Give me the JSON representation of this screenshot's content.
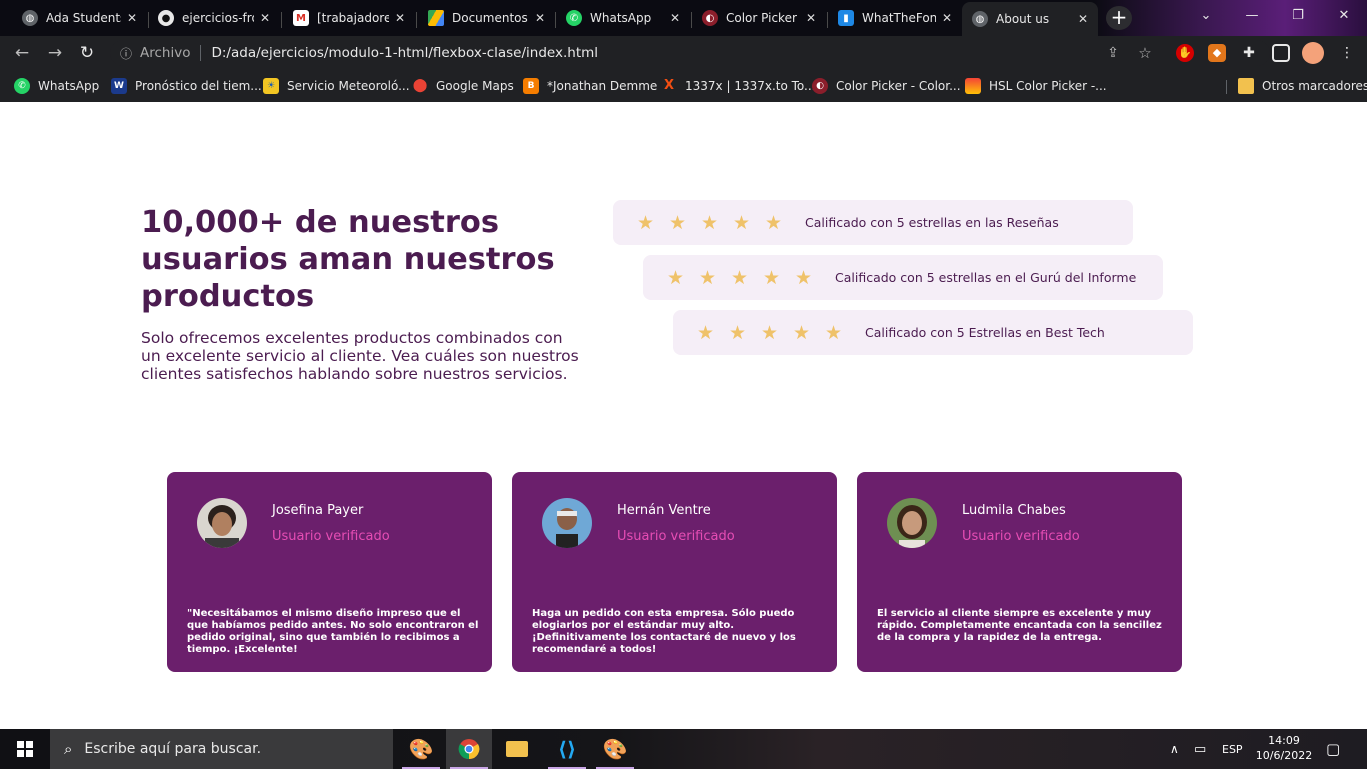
{
  "browser": {
    "tabs": [
      {
        "title": "Ada Students",
        "icon": "globe-icon",
        "active": false
      },
      {
        "title": "ejercicios-fron",
        "icon": "github-icon",
        "active": false
      },
      {
        "title": "[trabajadores]",
        "icon": "gmail-icon",
        "active": false
      },
      {
        "title": "Documentos",
        "icon": "google-drive-icon",
        "active": false
      },
      {
        "title": "WhatsApp",
        "icon": "whatsapp-icon",
        "active": false
      },
      {
        "title": "Color Picker -",
        "icon": "color-picker-icon",
        "active": false
      },
      {
        "title": "WhatTheFont",
        "icon": "whatthefont-icon",
        "active": false
      },
      {
        "title": "About us",
        "icon": "globe-icon",
        "active": true
      }
    ],
    "address": {
      "scheme_label": "Archivo",
      "url": "D:/ada/ejercicios/modulo-1-html/flexbox-clase/index.html"
    },
    "bookmarks": [
      {
        "label": "WhatsApp",
        "icon": "whatsapp-icon"
      },
      {
        "label": "Pronóstico del tiem...",
        "icon": "weather-channel-icon"
      },
      {
        "label": "Servicio Meteoroló...",
        "icon": "meteo-icon"
      },
      {
        "label": "Google Maps",
        "icon": "google-maps-icon"
      },
      {
        "label": "*Jonathan Demme",
        "icon": "blogger-icon"
      },
      {
        "label": "1337x | 1337x.to To...",
        "icon": "1337x-icon"
      },
      {
        "label": "Color Picker - Color...",
        "icon": "color-picker-icon"
      },
      {
        "label": "HSL Color Picker -...",
        "icon": "hsl-icon"
      }
    ],
    "other_bookmarks": "Otros marcadores"
  },
  "colors": {
    "heading": "#4b1c50",
    "rating_bg": "#f5eef7",
    "star": "#efc26a",
    "card_bg": "#6b1f6c",
    "verified": "#e64db4"
  },
  "intro": {
    "title": "10,000+ de nuestros usuarios aman nuestros productos",
    "description": "Solo ofrecemos excelentes productos combinados con un excelente servicio al cliente. Vea cuáles son nuestros clientes satisfechos hablando sobre nuestros servicios."
  },
  "ratings": [
    {
      "stars": 5,
      "text": "Calificado con 5 estrellas en las Reseñas"
    },
    {
      "stars": 5,
      "text": "Calificado con 5 estrellas en el Gurú del Informe"
    },
    {
      "stars": 5,
      "text": "Calificado con 5 Estrellas en Best Tech"
    }
  ],
  "testimonials": [
    {
      "name": "Josefina Payer",
      "status": "Usuario verificado",
      "quote": "\"Necesitábamos el mismo diseño impreso que el que habíamos pedido antes. No solo encontraron el pedido original, sino que también lo recibimos a tiempo. ¡Excelente!"
    },
    {
      "name": "Hernán Ventre",
      "status": "Usuario verificado",
      "quote": "Haga un pedido con esta empresa. Sólo puedo elogiarlos por el estándar muy alto. ¡Definitivamente los contactaré de nuevo y los recomendaré a todos!"
    },
    {
      "name": "Ludmila Chabes",
      "status": "Usuario verificado",
      "quote": "El servicio al cliente siempre es excelente y muy rápido. Completamente encantada con la sencillez de la compra y la rapidez de la entrega."
    }
  ],
  "taskbar": {
    "search_placeholder": "Escribe aquí para buscar.",
    "language": "ESP",
    "time": "14:09",
    "date": "10/6/2022"
  }
}
